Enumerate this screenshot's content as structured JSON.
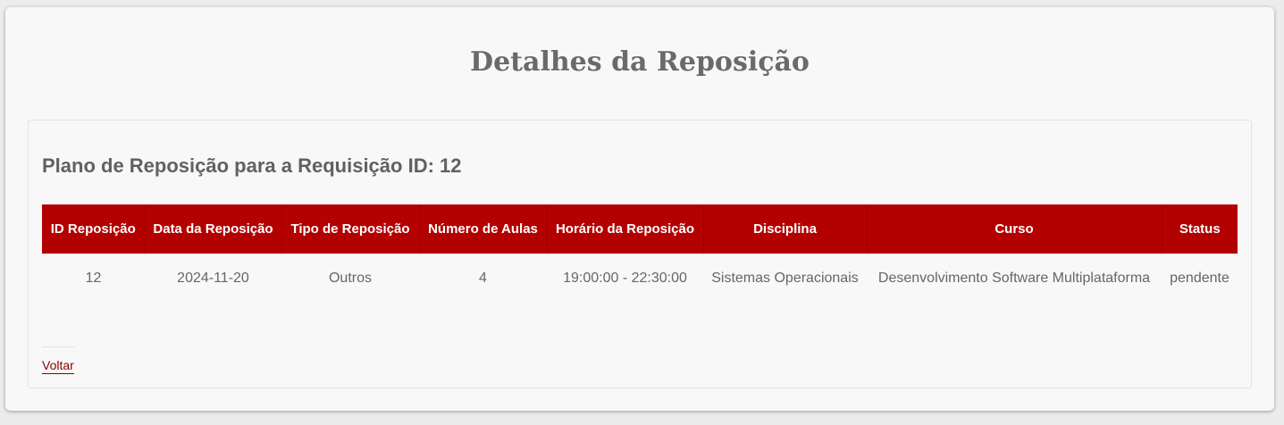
{
  "page": {
    "title": "Detalhes da Reposição"
  },
  "plan": {
    "heading": "Plano de Reposição para a Requisição ID: 12",
    "table": {
      "headers": [
        "ID Reposição",
        "Data da Reposição",
        "Tipo de Reposição",
        "Número de Aulas",
        "Horário da Reposição",
        "Disciplina",
        "Curso",
        "Status"
      ],
      "rows": [
        {
          "id": "12",
          "date": "2024-11-20",
          "type": "Outros",
          "lessons": "4",
          "time": "19:00:00 - 22:30:00",
          "discipline": "Sistemas Operacionais",
          "course": "Desenvolvimento Software Multiplataforma",
          "status": "pendente"
        }
      ]
    }
  },
  "actions": {
    "back_label": "Voltar"
  },
  "colors": {
    "header_bg": "#b30000",
    "link": "#8b0000",
    "title_text": "#6a6a6a"
  }
}
